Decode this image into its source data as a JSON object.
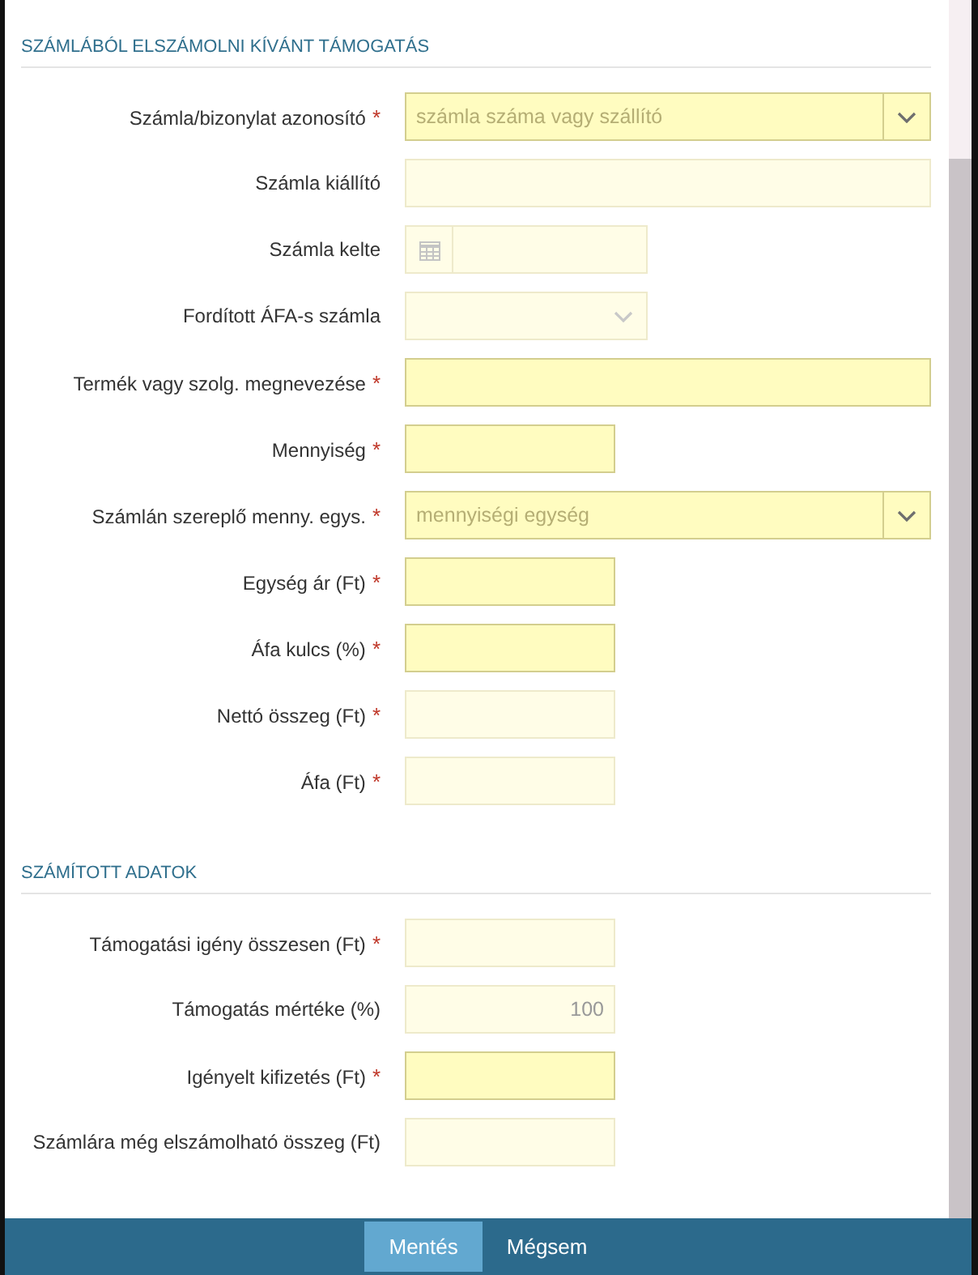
{
  "sections": [
    {
      "title": "SZÁMLÁBÓL ELSZÁMOLNI KÍVÁNT TÁMOGATÁS",
      "fields": [
        {
          "label": "Számla/bizonylat azonosító",
          "required_mark": "*",
          "kind": "combobox",
          "disabled": false,
          "placeholder": "számla száma vagy szállító"
        },
        {
          "label": "Számla kiállító",
          "kind": "text",
          "disabled": true
        },
        {
          "label": "Számla kelte",
          "kind": "date",
          "disabled": true
        },
        {
          "label": "Fordított ÁFA-s számla",
          "kind": "select",
          "disabled": true
        },
        {
          "label": "Termék vagy szolg. megnevezése",
          "required_mark": "*",
          "kind": "text",
          "disabled": false
        },
        {
          "label": "Mennyiség",
          "required_mark": "*",
          "kind": "number",
          "disabled": false
        },
        {
          "label": "Számlán szereplő menny. egys.",
          "required_mark": "*",
          "kind": "combobox",
          "disabled": false,
          "placeholder": "mennyiségi egység"
        },
        {
          "label": "Egység ár (Ft)",
          "required_mark": "*",
          "kind": "number",
          "disabled": false
        },
        {
          "label": "Áfa kulcs (%)",
          "required_mark": "*",
          "kind": "number",
          "disabled": false
        },
        {
          "label": "Nettó összeg (Ft)",
          "required_mark": "*",
          "kind": "number",
          "disabled": true
        },
        {
          "label": "Áfa (Ft)",
          "required_mark": "*",
          "kind": "number",
          "disabled": true
        }
      ]
    },
    {
      "title": "SZÁMÍTOTT ADATOK",
      "fields": [
        {
          "label": "Támogatási igény összesen (Ft)",
          "required_mark": "*",
          "kind": "number",
          "disabled": true
        },
        {
          "label": "Támogatás mértéke (%)",
          "kind": "number",
          "disabled": true,
          "value": "100"
        },
        {
          "label": "Igényelt kifizetés (Ft)",
          "required_mark": "*",
          "kind": "number",
          "disabled": false
        },
        {
          "label": "Számlára még elszámolható összeg (Ft)",
          "kind": "number",
          "disabled": true
        }
      ]
    }
  ],
  "footer": {
    "buttons": [
      {
        "label": "Mentés",
        "kind": "primary"
      },
      {
        "label": "Mégsem",
        "kind": "secondary"
      }
    ]
  }
}
